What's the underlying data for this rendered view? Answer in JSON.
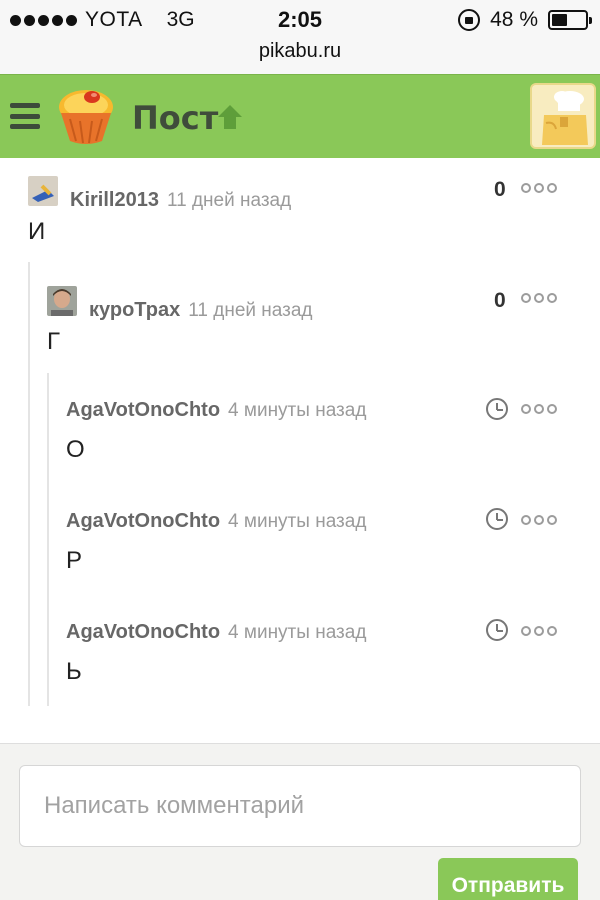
{
  "status_bar": {
    "carrier": "YOTA",
    "network": "3G",
    "time": "2:05",
    "battery_text": "48 %",
    "battery_level": 0.48
  },
  "browser": {
    "url": "pikabu.ru"
  },
  "header": {
    "title": "Пост",
    "accent_color": "#8ac858"
  },
  "comments": [
    {
      "author": "Kirill2013",
      "time": "11 дней назад",
      "text": "И",
      "score": "0"
    },
    {
      "author": "куроТрах",
      "time": "11 дней назад",
      "text": "Г",
      "score": "0"
    },
    {
      "author": "AgaVotOnoChto",
      "time": "4 минуты назад",
      "text": "О",
      "pending_icon": "clock-icon"
    },
    {
      "author": "AgaVotOnoChto",
      "time": "4 минуты назад",
      "text": "Р",
      "pending_icon": "clock-icon"
    },
    {
      "author": "AgaVotOnoChto",
      "time": "4 минуты назад",
      "text": "Ь",
      "pending_icon": "clock-icon"
    }
  ],
  "compose": {
    "placeholder": "Написать комментарий",
    "send_label": "Отправить"
  }
}
